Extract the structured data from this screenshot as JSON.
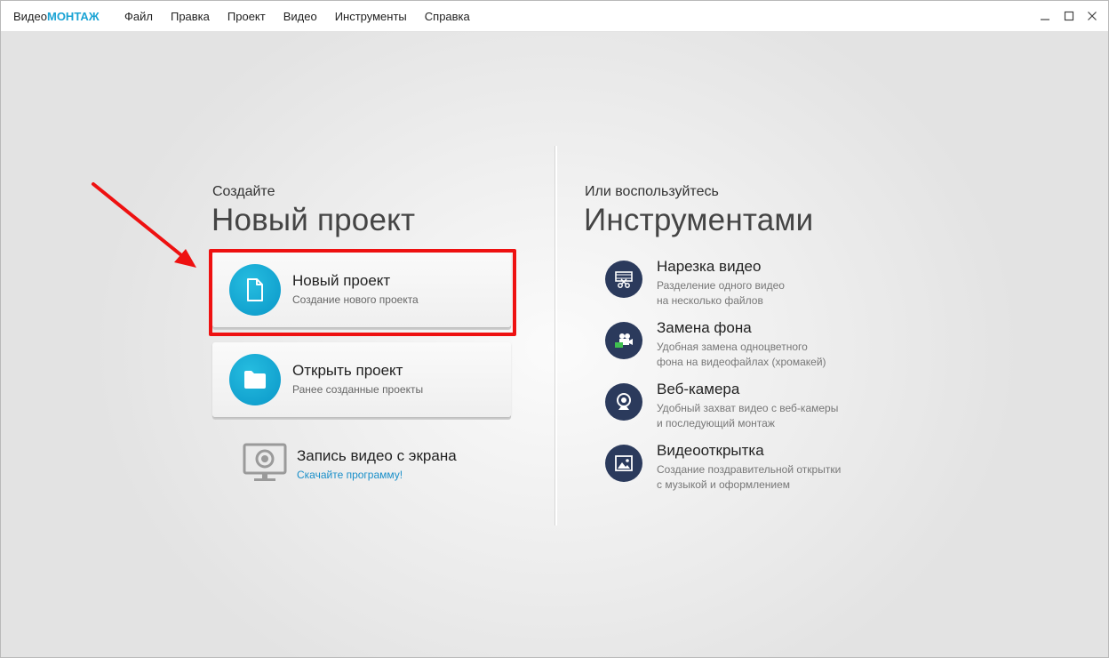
{
  "app": {
    "logo_prefix": "Видео",
    "logo_accent": "МОНТАЖ"
  },
  "menu": [
    "Файл",
    "Правка",
    "Проект",
    "Видео",
    "Инструменты",
    "Справка"
  ],
  "window_controls": {
    "minimize": "—",
    "maximize": "☐",
    "close": "✕"
  },
  "left": {
    "subtitle": "Создайте",
    "heading": "Новый проект",
    "cards": [
      {
        "title": "Новый проект",
        "desc": "Создание нового проекта",
        "icon": "document-icon"
      },
      {
        "title": "Открыть проект",
        "desc": "Ранее созданные проекты",
        "icon": "folder-icon"
      }
    ],
    "record": {
      "title": "Запись видео с экрана",
      "link": "Скачайте программу!",
      "icon": "monitor-webcam-icon"
    }
  },
  "right": {
    "subtitle": "Или воспользуйтесь",
    "heading": "Инструментами",
    "tools": [
      {
        "title": "Нарезка видео",
        "desc1": "Разделение одного видео",
        "desc2": "на несколько файлов",
        "icon": "film-scissors-icon"
      },
      {
        "title": "Замена фона",
        "desc1": "Удобная замена одноцветного",
        "desc2": "фона на видеофайлах (хромакей)",
        "icon": "chroma-camera-icon"
      },
      {
        "title": "Веб-камера",
        "desc1": "Удобный захват видео с веб-камеры",
        "desc2": "и последующий монтаж",
        "icon": "webcam-icon"
      },
      {
        "title": "Видеооткрытка",
        "desc1": "Создание поздравительной открытки",
        "desc2": "с музыкой и оформлением",
        "icon": "picture-icon"
      }
    ]
  },
  "colors": {
    "accent": "#1aa3d4",
    "highlight": "#ee1111",
    "tool_icon_bg": "#2b3a5c",
    "link": "#1a8fc9"
  }
}
